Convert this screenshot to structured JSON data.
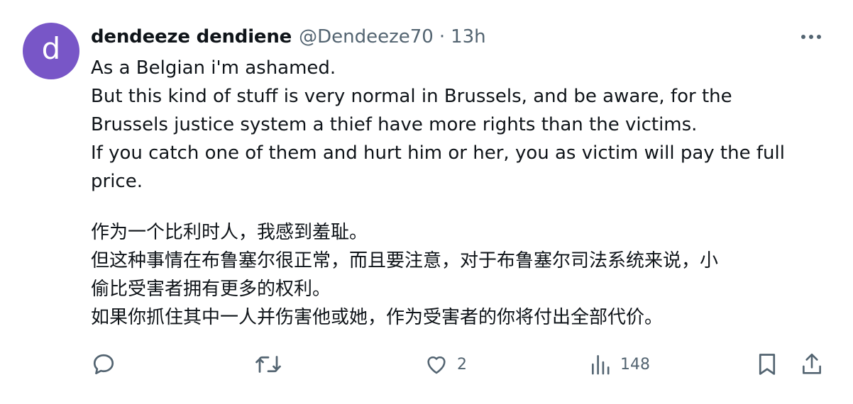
{
  "author": {
    "avatar_letter": "d",
    "display_name": "dendeeze dendiene",
    "handle": "@Dendeeze70",
    "separator": "·",
    "time": "13h"
  },
  "tweet": {
    "english_lines": [
      "As a Belgian i'm ashamed.",
      "But this kind of stuff is very normal in Brussels, and be aware, for the",
      "Brussels justice system a thief have more rights than the victims.",
      "If you catch one of them and hurt him or her, you as victim will pay the full",
      "price."
    ],
    "chinese_lines": [
      "作为一个比利时人，我感到羞耻。",
      "但这种事情在布鲁塞尔很正常，而且要注意，对于布鲁塞尔司法系统来说，小",
      "偷比受害者拥有更多的权利。",
      "如果你抓住其中一人并伤害他或她，作为受害者的你将付出全部代价。"
    ]
  },
  "actions": {
    "reply": {
      "icon": "reply-icon"
    },
    "retweet": {
      "icon": "retweet-icon"
    },
    "like": {
      "icon": "heart-icon",
      "count": "2"
    },
    "views": {
      "icon": "views-chart-icon",
      "count": "148"
    },
    "bookmark": {
      "icon": "bookmark-icon"
    },
    "share": {
      "icon": "share-icon"
    }
  },
  "colors": {
    "avatar_bg": "#7856c7",
    "text_primary": "#0f1419",
    "text_secondary": "#536471"
  }
}
